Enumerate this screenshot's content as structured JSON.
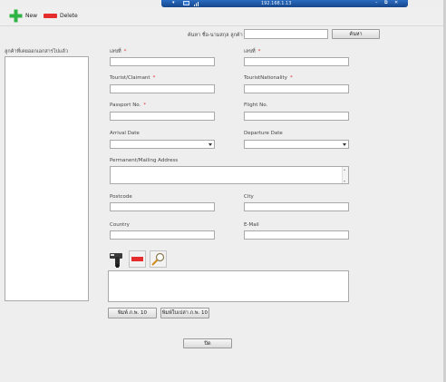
{
  "remote_bar": {
    "ip": "192.168.1.13"
  },
  "toolbar": {
    "new_label": "New",
    "delete_label": "Delete"
  },
  "search": {
    "label": "ค้นหา ชื่อ-นามสกุล ลูกค้า",
    "value": "",
    "button_label": "ค้นหา"
  },
  "left_panel": {
    "title": "ลูกค้าที่เคยออกเอกสารไปแล้ว",
    "items": []
  },
  "form": {
    "field_1": {
      "label": "เลขที่",
      "value": ""
    },
    "field_2": {
      "label": "เลขที่",
      "value": ""
    },
    "tourist": {
      "label": "Tourist/Claimant",
      "value": ""
    },
    "nationality": {
      "label": "TouristNationality",
      "value": ""
    },
    "passport": {
      "label": "Passport No.",
      "value": ""
    },
    "flight": {
      "label": "Flight No.",
      "value": ""
    },
    "arrival": {
      "label": "Arrival Date",
      "value": ""
    },
    "departure": {
      "label": "Departure Date",
      "value": ""
    },
    "address": {
      "label": "Permanent/Mailing Address",
      "value": ""
    },
    "postcode": {
      "label": "Postcode",
      "value": ""
    },
    "city": {
      "label": "City",
      "value": ""
    },
    "country": {
      "label": "Country",
      "value": ""
    },
    "email": {
      "label": "E-Mail",
      "value": ""
    },
    "required_mark": "*"
  },
  "tools": {
    "icons": [
      "card-reader-icon",
      "red-bar-icon",
      "magnifier-icon"
    ],
    "notes_value": ""
  },
  "buttons": {
    "print_label": "พิมพ์ ภ.พ. 10",
    "print_blank_label": "พิมพ์ใบเปล่า ภ.พ. 10",
    "close_label": "ปิด"
  },
  "colors": {
    "remote_bar": "#1e5aa0",
    "add_green": "#2fb344",
    "delete_red": "#e52d2d",
    "required_red": "#e03030"
  }
}
